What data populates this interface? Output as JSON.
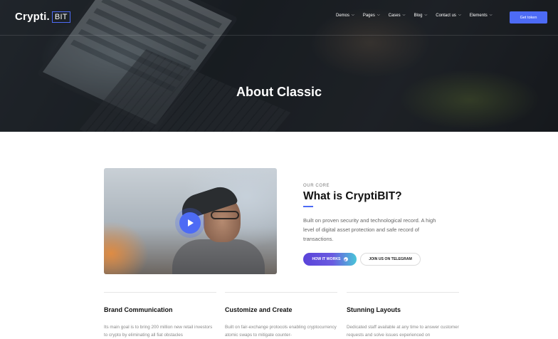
{
  "nav": {
    "logo_text": "Crypti.",
    "logo_box": "BIT",
    "items": [
      {
        "label": "Demos"
      },
      {
        "label": "Pages"
      },
      {
        "label": "Cases"
      },
      {
        "label": "Blog"
      },
      {
        "label": "Contact us"
      },
      {
        "label": "Elements"
      }
    ],
    "cta_label": "Get token"
  },
  "hero": {
    "title": "About Classic"
  },
  "about": {
    "eyebrow": "OUR CORE",
    "title": "What is CryptiBIT?",
    "text": "Built on proven security and technological record. A high level of digital asset protection and safe record of transactions.",
    "primary_button": "HOW IT WORKS",
    "secondary_button": "JOIN US ON TELEGRAM"
  },
  "features": [
    {
      "title": "Brand Communication",
      "text": "Its main goal is to bring 200 million new retail investors to crypto by eliminating all fiat obstacles"
    },
    {
      "title": "Customize and Create",
      "text": "Built on fair-exchange protocols enabling cryptocurrency atomic swaps to mitigate counter-"
    },
    {
      "title": "Stunning Layouts",
      "text": "Dedicated staff available at any time to answer customer requests and solve issues experienced on"
    }
  ],
  "colors": {
    "accent": "#4d6bf5",
    "gradient_start": "#5a43d9",
    "gradient_end": "#49c6d8"
  }
}
